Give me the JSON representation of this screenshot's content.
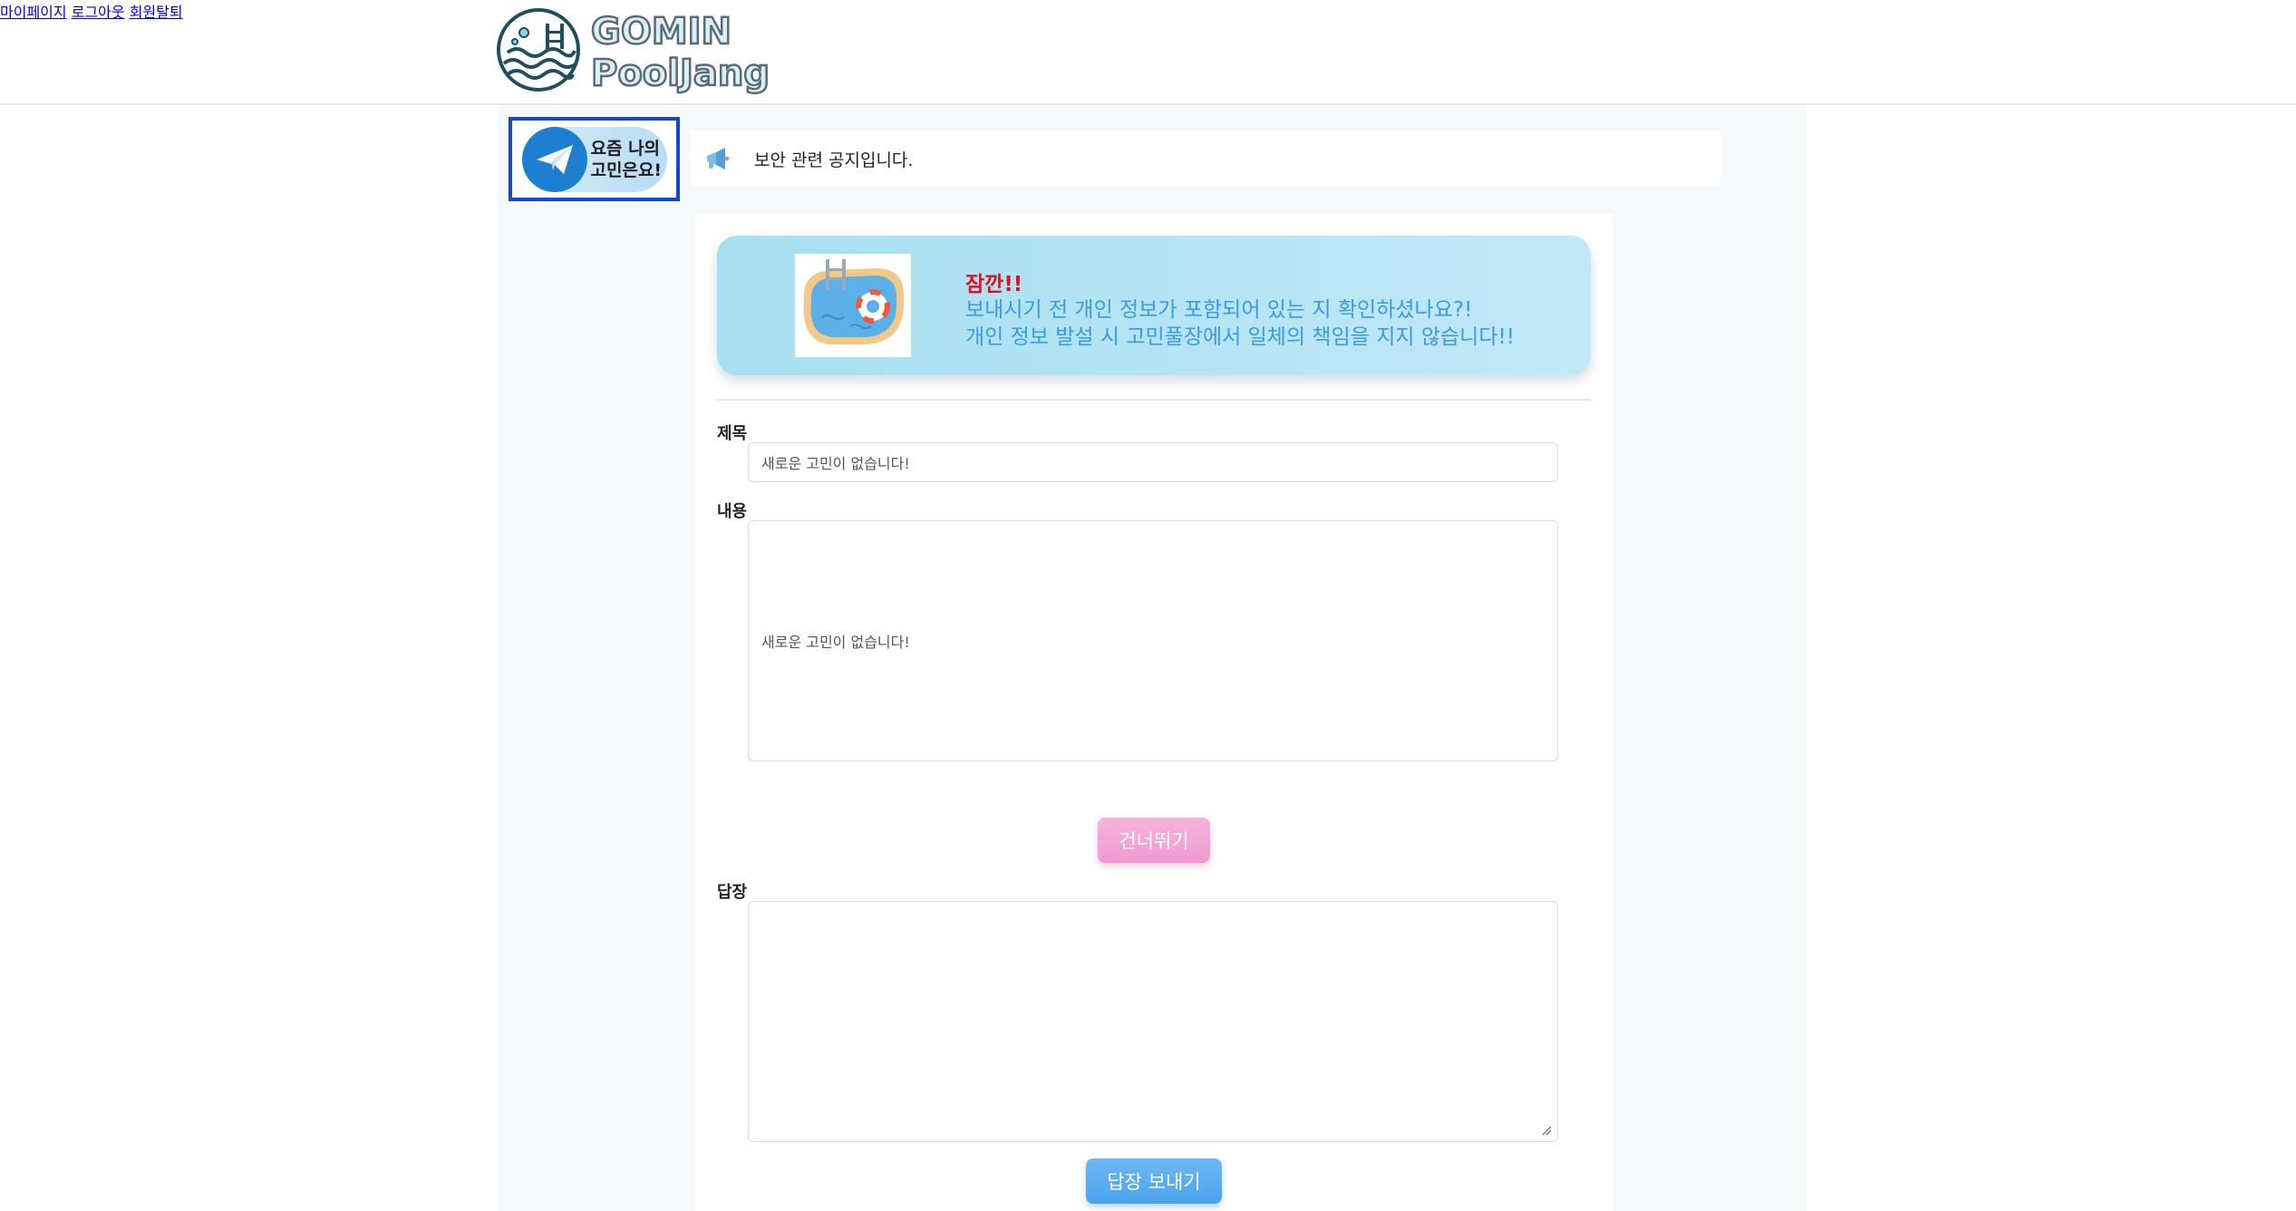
{
  "header": {
    "logo_line1": "GOMIN",
    "logo_line2": "PoolJang",
    "nav": [
      "마이페이지",
      "로그아웃",
      "회원탈퇴"
    ]
  },
  "sidebar": {
    "button_label": "요즘 나의\n고민은요!",
    "icon": "paper-plane-icon"
  },
  "notice": {
    "icon": "megaphone-icon",
    "text": "보안 관련 공지입니다."
  },
  "warning": {
    "title": "잠깐!!",
    "line1": "보내시기 전 개인 정보가 포함되어 있는 지 확인하셨나요?!",
    "line2": "개인 정보 발설 시 고민풀장에서 일체의 책임을 지지 않습니다!!",
    "image": "pool-illustration"
  },
  "form": {
    "title_label": "제목",
    "title_value": "새로운 고민이 없습니다!",
    "content_label": "내용",
    "content_value": "새로운 고민이 없습니다!",
    "skip_button": "건너뛰기",
    "reply_label": "답장",
    "reply_value": "",
    "send_button": "답장 보내기"
  },
  "colors": {
    "accent_blue": "#1347d6",
    "warning_red": "#e0101e",
    "warning_text": "#3b9be0",
    "skip_pink": "#f19ad0",
    "send_blue": "#4aa3ee"
  }
}
